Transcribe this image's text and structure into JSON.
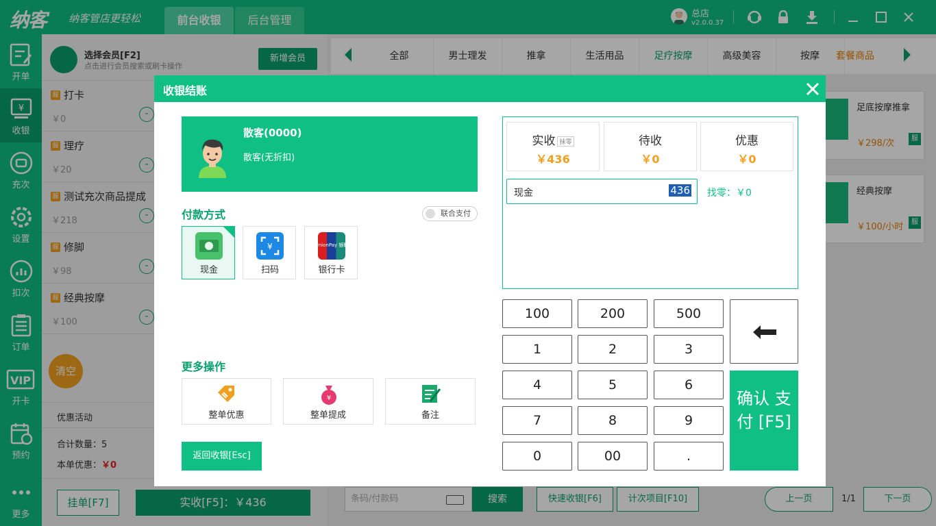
{
  "app": {
    "logo": "纳客",
    "slogan": "纳客管店更轻松"
  },
  "top_tabs": [
    "前台收银",
    "后台管理"
  ],
  "user": {
    "name": "总店",
    "version": "v2.0.0.37"
  },
  "sidebar": [
    "开单",
    "收银",
    "充次",
    "设置",
    "扣次",
    "订单",
    "开卡",
    "预约",
    "更多"
  ],
  "member": {
    "title": "选择会员[F2]",
    "subtitle": "点击进行会员搜索或刷卡操作",
    "new_button": "新增会员"
  },
  "items": [
    {
      "tag": "服",
      "name": "打卡",
      "price": "￥0"
    },
    {
      "tag": "服",
      "name": "理疗",
      "price": "￥20"
    },
    {
      "tag": "服",
      "name": "测试充次商品提成",
      "price": "￥218"
    },
    {
      "tag": "服",
      "name": "修脚",
      "price": "￥98"
    },
    {
      "tag": "服",
      "name": "经典按摩",
      "price": "￥100"
    }
  ],
  "left": {
    "clear": "清空",
    "promo": "优惠活动",
    "qty": "合计数量：5",
    "discount_label": "本单优惠：",
    "discount_value": "￥0",
    "hang": "挂单[F7]",
    "pay": "实收[F5]：￥436"
  },
  "categories": [
    "全部",
    "男士理发",
    "推拿",
    "生活用品",
    "足疗按摩",
    "高级美容",
    "按摩"
  ],
  "category_extra": "套餐商品",
  "products": [
    {
      "name": "足底按摩推拿",
      "price": "￥298/次",
      "badge": "服"
    },
    {
      "name": "经典按摩",
      "price": "￥100/小时",
      "badge": "服"
    }
  ],
  "right_bottom": {
    "barcode_placeholder": "条码/付款码",
    "search": "搜索",
    "quick": "快速收银[F6]",
    "count": "计次项目[F10]",
    "prev": "上一页",
    "page": "1/1",
    "next": "下一页"
  },
  "modal": {
    "title": "收银结账",
    "customer_name": "散客(0000)",
    "customer_sub": "散客(无折扣)",
    "pay_section": "付款方式",
    "combined": "联合支付",
    "methods": [
      "现金",
      "扫码",
      "银行卡"
    ],
    "unionpay_text": "UnionPay 银联",
    "more_section": "更多操作",
    "ops": [
      "整单优惠",
      "整单提成",
      "备注"
    ],
    "back": "返回收银[Esc]",
    "summary": [
      {
        "label": "实收",
        "value": "￥436",
        "round": "抹零"
      },
      {
        "label": "待收",
        "value": "￥0"
      },
      {
        "label": "优惠",
        "value": "￥0"
      }
    ],
    "cash_label": "现金",
    "cash_value": "436",
    "change": "找零：￥0",
    "keys": [
      "100",
      "200",
      "500",
      "1",
      "2",
      "3",
      "4",
      "5",
      "6",
      "7",
      "8",
      "9",
      "0",
      "00",
      "."
    ],
    "confirm": "确认 支付 [F5]"
  },
  "colors": {
    "primary": "#0fbf84",
    "dark": "#0a9f6e",
    "accent": "#f0a020",
    "danger": "#e62222"
  }
}
